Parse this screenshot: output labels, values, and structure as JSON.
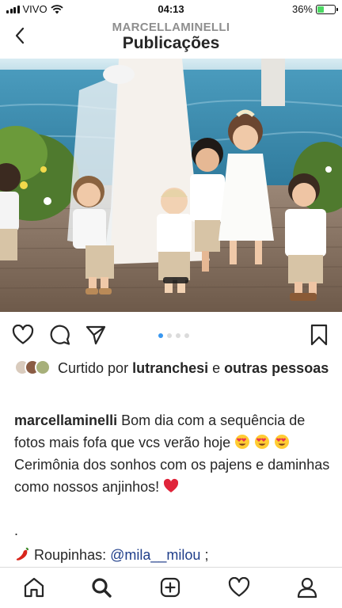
{
  "status_bar": {
    "carrier": "VIVO",
    "time": "04:13",
    "battery": "36%",
    "battery_level": 0.36,
    "battery_color": "#4cd964"
  },
  "header": {
    "back_icon": "chevron-left-icon",
    "username": "MARCELLAMINELLI",
    "title": "Publicações"
  },
  "post": {
    "photo_description_colors": {
      "sea": "#3f8fb0",
      "sky": "#cfe6ef",
      "deck": "#8a7664"
    },
    "actions": [
      "heart-icon",
      "comment-icon",
      "share-icon",
      "bookmark-icon"
    ],
    "carousel": {
      "count": 4,
      "active_index": 0,
      "active_color": "#3897f0"
    },
    "likes": {
      "prefix": "Curtido por",
      "user": "lutranchesi",
      "connector": "e",
      "others": "outras pessoas"
    },
    "caption": {
      "author": "marcellaminelli",
      "text_1": "Bom dia com a sequência de fotos mais fofa que vcs verão hoje",
      "text_2": "Cerimônia dos sonhos com os pajens e daminhas como nossos anjinhos!",
      "separator": ".",
      "outfit_label": "Roupinhas:",
      "outfit_handle": "@mila__milou",
      "outfit_tail": ";"
    }
  },
  "tab_bar": {
    "items": [
      "home-icon",
      "search-icon",
      "new-post-icon",
      "activity-icon",
      "profile-icon"
    ]
  }
}
